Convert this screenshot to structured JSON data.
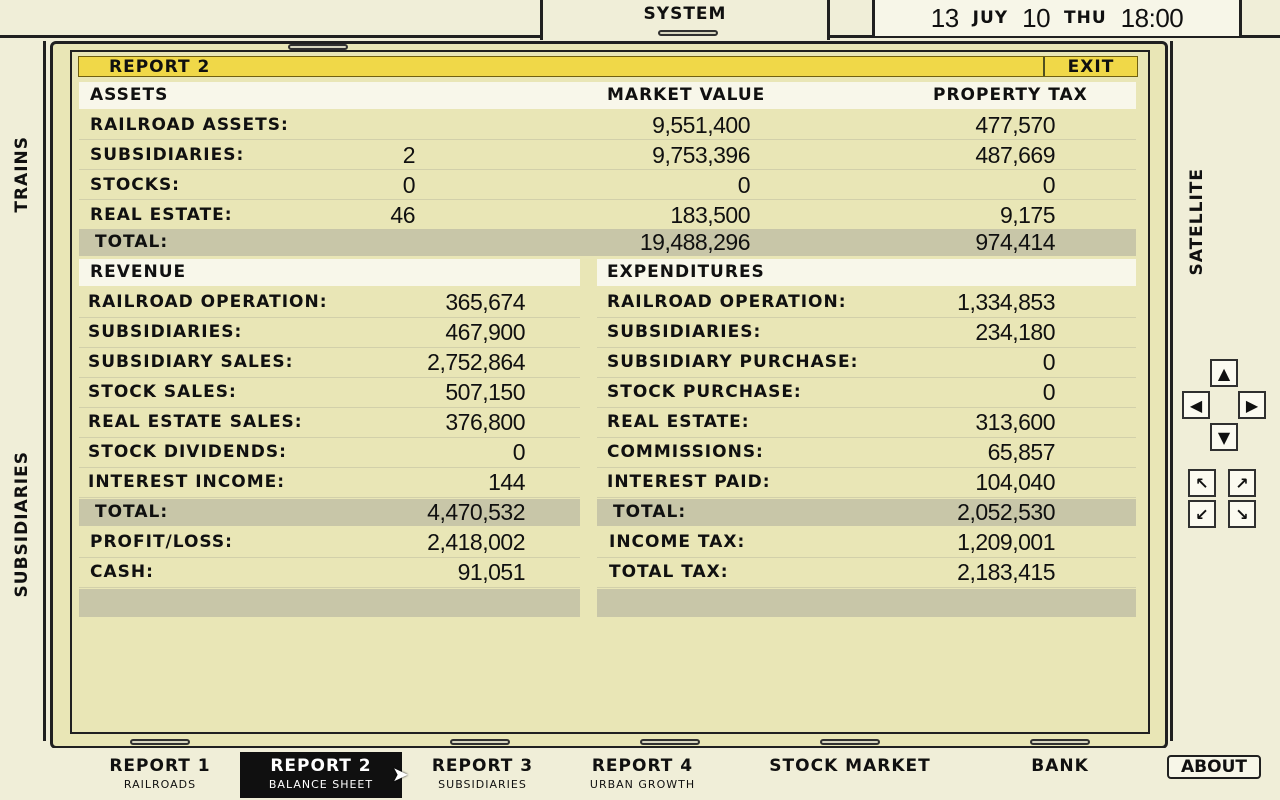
{
  "topbar": {
    "system_label": "SYSTEM",
    "date": {
      "day": "13",
      "month": "JUY",
      "year": "10",
      "weekday": "THU",
      "time": "18:00"
    }
  },
  "sidebar": {
    "left": {
      "trains_label": "TRAINS",
      "subsidiaries_label": "SUBSIDIARIES"
    },
    "right": {
      "satellite_label": "SATELLITE"
    }
  },
  "report": {
    "title": "REPORT 2",
    "exit_label": "EXIT",
    "assets": {
      "headers": {
        "assets": "ASSETS",
        "market_value": "MARKET VALUE",
        "property_tax": "PROPERTY TAX"
      },
      "rows": [
        {
          "label": "RAILROAD ASSETS:",
          "count": "",
          "market_value": "9,551,400",
          "property_tax": "477,570"
        },
        {
          "label": "SUBSIDIARIES:",
          "count": "2",
          "market_value": "9,753,396",
          "property_tax": "487,669"
        },
        {
          "label": "STOCKS:",
          "count": "0",
          "market_value": "0",
          "property_tax": "0"
        },
        {
          "label": "REAL ESTATE:",
          "count": "46",
          "market_value": "183,500",
          "property_tax": "9,175"
        }
      ],
      "total": {
        "label": "TOTAL:",
        "market_value": "19,488,296",
        "property_tax": "974,414"
      }
    },
    "revenue": {
      "header": "REVENUE",
      "rows": [
        {
          "label": "RAILROAD OPERATION:",
          "value": "365,674"
        },
        {
          "label": "SUBSIDIARIES:",
          "value": "467,900"
        },
        {
          "label": "SUBSIDIARY SALES:",
          "value": "2,752,864"
        },
        {
          "label": "STOCK SALES:",
          "value": "507,150"
        },
        {
          "label": "REAL ESTATE SALES:",
          "value": "376,800"
        },
        {
          "label": "STOCK DIVIDENDS:",
          "value": "0"
        },
        {
          "label": "INTEREST INCOME:",
          "value": "144"
        }
      ],
      "total": {
        "label": "TOTAL:",
        "value": "4,470,532"
      },
      "extra": [
        {
          "label": "PROFIT/LOSS:",
          "value": "2,418,002"
        },
        {
          "label": "CASH:",
          "value": "91,051"
        }
      ]
    },
    "expenditures": {
      "header": "EXPENDITURES",
      "rows": [
        {
          "label": "RAILROAD OPERATION:",
          "value": "1,334,853"
        },
        {
          "label": "SUBSIDIARIES:",
          "value": "234,180"
        },
        {
          "label": "SUBSIDIARY PURCHASE:",
          "value": "0"
        },
        {
          "label": "STOCK PURCHASE:",
          "value": "0"
        },
        {
          "label": "REAL ESTATE:",
          "value": "313,600"
        },
        {
          "label": "COMMISSIONS:",
          "value": "65,857"
        },
        {
          "label": "INTEREST PAID:",
          "value": "104,040"
        }
      ],
      "total": {
        "label": "TOTAL:",
        "value": "2,052,530"
      },
      "extra": [
        {
          "label": "INCOME TAX:",
          "value": "1,209,001"
        },
        {
          "label": "TOTAL TAX:",
          "value": "2,183,415"
        }
      ]
    }
  },
  "bottom_tabs": [
    {
      "label": "REPORT 1",
      "sublabel": "RAILROADS",
      "active": false
    },
    {
      "label": "REPORT 2",
      "sublabel": "BALANCE SHEET",
      "active": true
    },
    {
      "label": "REPORT 3",
      "sublabel": "SUBSIDIARIES",
      "active": false
    },
    {
      "label": "REPORT 4",
      "sublabel": "URBAN GROWTH",
      "active": false
    },
    {
      "label": "STOCK MARKET",
      "sublabel": "",
      "active": false
    },
    {
      "label": "BANK",
      "sublabel": "",
      "active": false
    }
  ],
  "about_label": "ABOUT",
  "colors": {
    "title_bar": "#f0d848",
    "panel": "#e9e6b6",
    "row_white": "#f8f7ea",
    "row_total": "#c8c6a8",
    "active_tab": "#101010"
  },
  "icons": [
    "arrow-up-icon",
    "arrow-left-icon",
    "arrow-right-icon",
    "arrow-down-icon",
    "arrow-nw-icon",
    "arrow-ne-icon",
    "arrow-sw-icon",
    "arrow-se-icon",
    "mouse-cursor-icon"
  ]
}
